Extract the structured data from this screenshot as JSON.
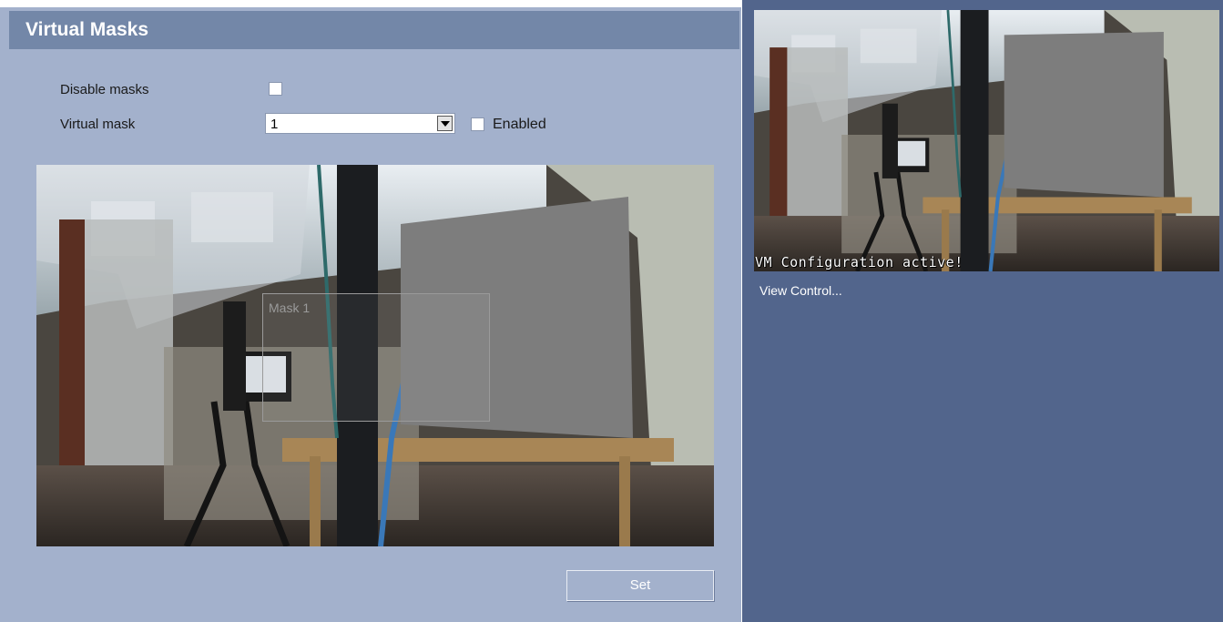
{
  "page": {
    "title": "Virtual Masks"
  },
  "form": {
    "disable_masks_label": "Disable masks",
    "disable_masks_checked": false,
    "virtual_mask_label": "Virtual mask",
    "virtual_mask_value": "1",
    "enabled_label": "Enabled",
    "enabled_checked": false
  },
  "editor": {
    "mask_label": "Mask 1"
  },
  "actions": {
    "set_label": "Set"
  },
  "preview": {
    "overlay_text": "VM Configuration active!",
    "view_control_label": "View Control..."
  },
  "colors": {
    "panel_bg": "#a3b1cc",
    "title_bar": "#7387a8",
    "preview_bg": "#52658c",
    "privacy_mask": "#7d7d7d"
  }
}
